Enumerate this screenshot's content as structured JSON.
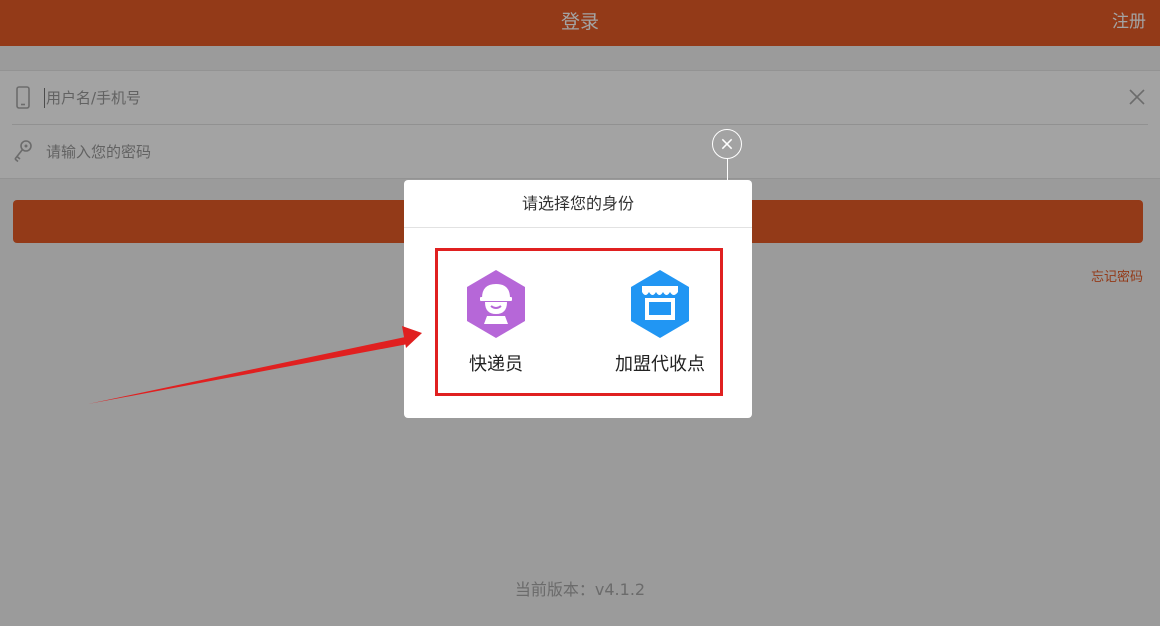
{
  "header": {
    "title": "登录",
    "register_label": "注册"
  },
  "form": {
    "username_placeholder": "用户名/手机号",
    "password_placeholder": "请输入您的密码",
    "forgot_label": "忘记密码",
    "phone_icon": "phone-icon",
    "key_icon": "key-icon",
    "clear_icon": "close-icon"
  },
  "version_label": "当前版本：v4.1.2",
  "dialog": {
    "title": "请选择您的身份",
    "options": [
      {
        "label": "快递员",
        "icon": "courier-icon",
        "color": "#b667d8"
      },
      {
        "label": "加盟代收点",
        "icon": "store-icon",
        "color": "#2196f3"
      }
    ]
  },
  "colors": {
    "brand": "#e75c27",
    "highlight": "#e02020",
    "arrow": "#e02020"
  }
}
